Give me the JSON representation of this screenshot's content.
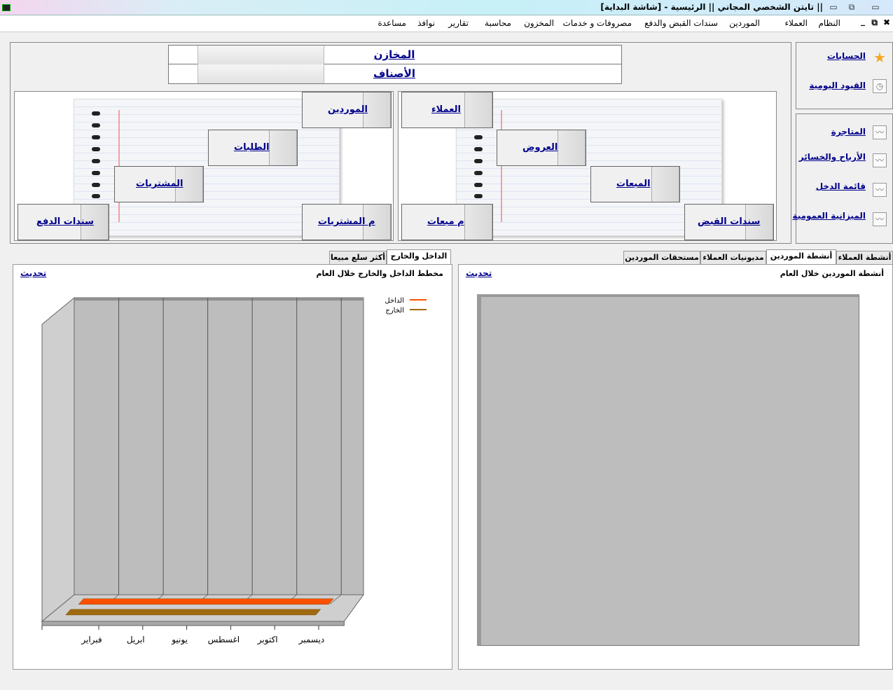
{
  "window": {
    "title": "|| تايتن الشخصي المجاني || الرئيسية - [شاشة البداية]"
  },
  "menu": {
    "items": [
      "النظام",
      "العملاء",
      "الموردين",
      "سندات القبض والدفع",
      "مصروفات و خدمات",
      "المخزون",
      "محاسبة",
      "تقارير",
      "نوافذ",
      "مساعدة"
    ]
  },
  "side_top": {
    "links": [
      "الحسابات",
      "القيود اليومية"
    ]
  },
  "side_bottom": {
    "links": [
      "المتاجرة",
      "الأرباح والخسائر",
      "قائمة الدخل",
      "الميزانية العمومية"
    ]
  },
  "header_table": {
    "rows": [
      "المخازن",
      "الأصناف"
    ]
  },
  "customers_notebook": {
    "customers": "العملاء",
    "offers": "العروض",
    "sales": "المبعات",
    "receipts": "سندات القبض",
    "sales_returns": "م مبعات"
  },
  "suppliers_notebook": {
    "suppliers": "الموردين",
    "orders": "الطلبات",
    "purchases": "المشتريات",
    "payments": "سندات الدفع",
    "purchase_returns": "م المشتريات"
  },
  "right_tabs": {
    "tabs": [
      "أنشطة العملاء",
      "أنشطة الموردين",
      "مديونيات العملاء",
      "مستحقات الموردين"
    ],
    "active_index": 1,
    "pane_title": "أنشطة الموردين خلال العام",
    "refresh": "تحديث"
  },
  "left_tabs": {
    "tabs": [
      "الداخل والخارج",
      "أكثر سلع مبيعا"
    ],
    "active_index": 0,
    "pane_title": "مخطط الداخل والخارج خلال العام",
    "refresh": "تحديث"
  },
  "chart_data": {
    "type": "bar",
    "title": "مخطط الداخل والخارج خلال العام",
    "categories": [
      "ديسمبر",
      "اكتوبر",
      "اغسطس",
      "يونيو",
      "ابريل",
      "فبراير"
    ],
    "series": [
      {
        "name": "الداخل",
        "values": [
          0,
          0,
          0,
          0,
          0,
          0
        ],
        "color": "#ff5000"
      },
      {
        "name": "الخارج",
        "values": [
          0,
          0,
          0,
          0,
          0,
          0
        ],
        "color": "#a06a10"
      }
    ],
    "legend_position": "top-right",
    "grid": true,
    "style": "3d"
  }
}
